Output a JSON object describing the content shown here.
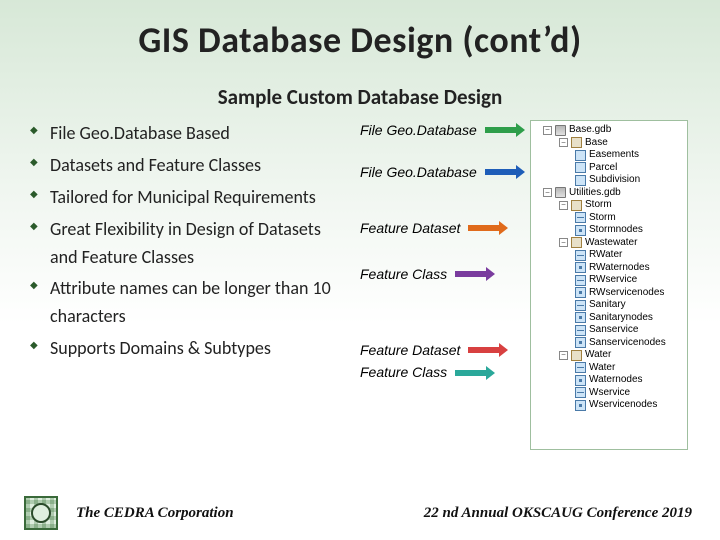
{
  "title": "GIS Database Design (cont’d)",
  "subtitle": "Sample Custom Database Design",
  "bullets": [
    "File Geo.Database Based",
    "Datasets and Feature Classes",
    "Tailored for Municipal Requirements",
    "Great Flexibility in Design of Datasets and Feature Classes",
    "Attribute names can be longer than 10 characters",
    "Supports Domains & Subtypes"
  ],
  "labels": {
    "gdb1": "File Geo.Database",
    "gdb2": "File Geo.Database",
    "fds1": "Feature Dataset",
    "fc1": "Feature Class",
    "fds2": "Feature Dataset",
    "fc2": "Feature Class"
  },
  "tree": {
    "root1": "Base.gdb",
    "base_ds": "Base",
    "base_items": [
      "Easements",
      "Parcel",
      "Subdivision"
    ],
    "root2": "Utilities.gdb",
    "util_ds": [
      "Storm",
      "Wastewater",
      "Water"
    ],
    "storm_items": [
      "Storm",
      "Stormnodes"
    ],
    "waste_items": [
      "RWater",
      "RWaternodes",
      "RWservice",
      "RWservicenodes",
      "Sanitary",
      "Sanitarynodes",
      "Sanservice",
      "Sanservicenodes"
    ],
    "water_items": [
      "Water",
      "Waternodes",
      "Wservice",
      "Wservicenodes"
    ]
  },
  "footer": {
    "corp": "The CEDRA Corporation",
    "conf": "22 nd Annual OKSCAUG Conference 2019"
  }
}
